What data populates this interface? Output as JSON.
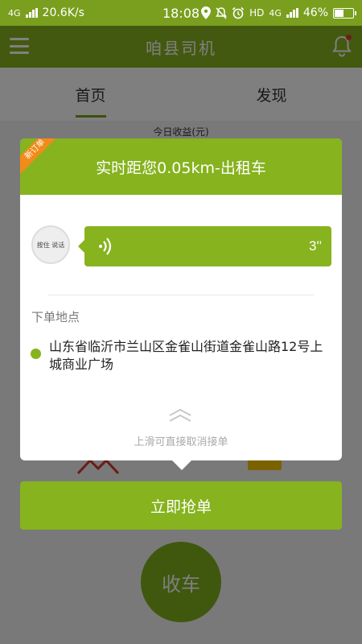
{
  "status_bar": {
    "network_type": "4G",
    "speed": "20.6K/s",
    "time": "18:08",
    "hd_label": "HD",
    "network_type_right": "4G",
    "battery": "46%"
  },
  "app_bar": {
    "title": "咱县司机"
  },
  "tabs": [
    {
      "label": "首页",
      "active": true
    },
    {
      "label": "发现",
      "active": false
    }
  ],
  "earnings": {
    "label": "今日收益(元)"
  },
  "order_dialog": {
    "badge": "新订单",
    "header": "实时距您0.05km-出租车",
    "voice": {
      "avatar_text": "按住 说话",
      "duration": "3''"
    },
    "pickup_label": "下单地点",
    "address": "山东省临沂市兰山区金雀山街道金雀山路12号上城商业广场",
    "swipe_hint": "上滑可直接取消接单"
  },
  "grab_button": {
    "label": "立即抢单"
  },
  "stop_button": {
    "label": "收车"
  },
  "colors": {
    "accent": "#86b31e",
    "badge": "#f28b19",
    "notification_dot": "#e53935"
  },
  "icons": [
    "menu-icon",
    "bell-icon",
    "location-icon",
    "mute-icon",
    "alarm-icon",
    "voice-wave-icon",
    "swipe-up-icon"
  ]
}
